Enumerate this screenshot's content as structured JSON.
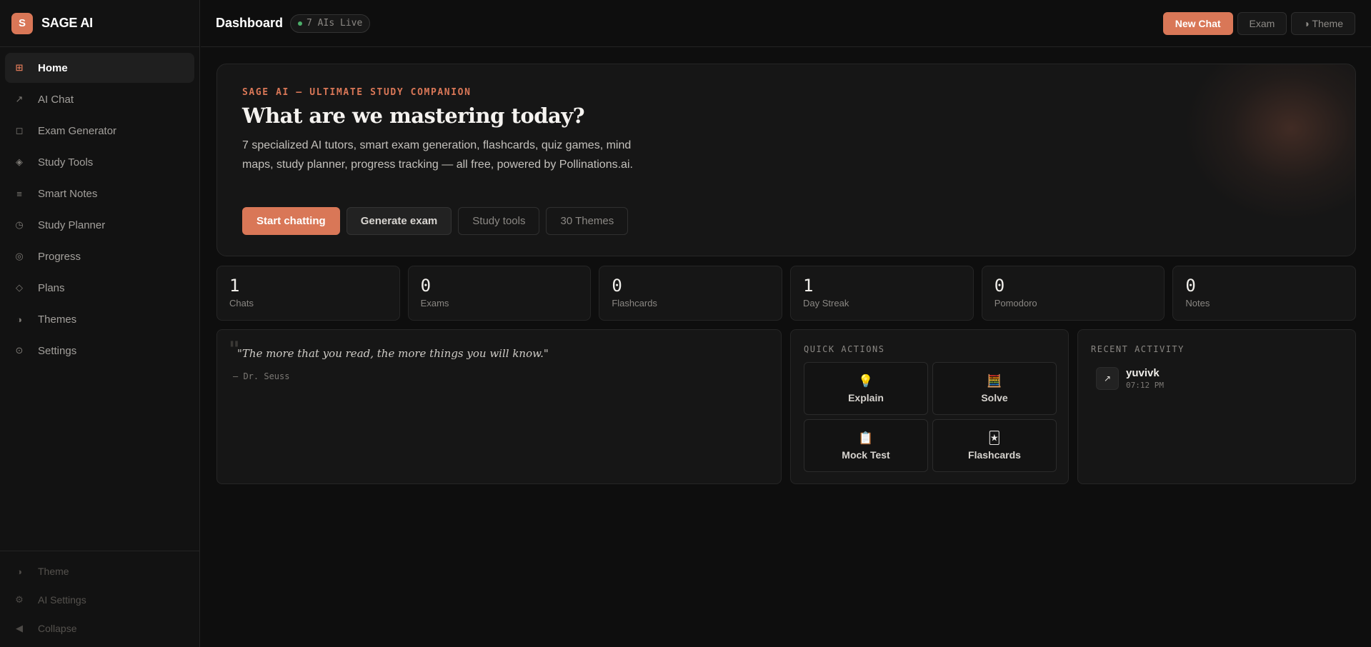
{
  "brand": {
    "logo_letter": "S",
    "name": "SAGE AI",
    "accent": "#d97757"
  },
  "sidebar": {
    "items": [
      {
        "label": "Home",
        "icon": "grid-icon",
        "glyph": "⊞",
        "active": true
      },
      {
        "label": "AI Chat",
        "icon": "arrow-icon",
        "glyph": "↗",
        "active": false
      },
      {
        "label": "Exam Generator",
        "icon": "square-icon",
        "glyph": "◻",
        "active": false
      },
      {
        "label": "Study Tools",
        "icon": "diamond-dot-icon",
        "glyph": "◈",
        "active": false
      },
      {
        "label": "Smart Notes",
        "icon": "lines-icon",
        "glyph": "≡",
        "active": false
      },
      {
        "label": "Study Planner",
        "icon": "clock-icon",
        "glyph": "◷",
        "active": false
      },
      {
        "label": "Progress",
        "icon": "target-icon",
        "glyph": "◎",
        "active": false
      },
      {
        "label": "Plans",
        "icon": "diamond-icon",
        "glyph": "◇",
        "active": false
      },
      {
        "label": "Themes",
        "icon": "half-circle-icon",
        "glyph": "◑",
        "active": false
      },
      {
        "label": "Settings",
        "icon": "gear-icon",
        "glyph": "⊙",
        "active": false
      }
    ],
    "footer": [
      {
        "label": "Theme",
        "icon": "half-circle-icon",
        "glyph": "◑"
      },
      {
        "label": "AI Settings",
        "icon": "gear-icon",
        "glyph": "⚙"
      },
      {
        "label": "Collapse",
        "icon": "collapse-icon",
        "glyph": "◀"
      }
    ]
  },
  "header": {
    "title": "Dashboard",
    "live_badge": "7 AIs Live",
    "new_chat_label": "New Chat",
    "exam_label": "Exam",
    "theme_label": "◑ Theme"
  },
  "hero": {
    "eyebrow": "SAGE AI — ULTIMATE STUDY COMPANION",
    "title": "What are we mastering today?",
    "description": "7 specialized AI tutors, smart exam generation, flashcards, quiz games, mind maps, study planner, progress tracking — all free, powered by Pollinations.ai.",
    "buttons": {
      "start": "Start chatting",
      "generate": "Generate exam",
      "tools": "Study tools",
      "themes": "30 Themes"
    }
  },
  "stats": [
    {
      "value": "1",
      "label": "Chats"
    },
    {
      "value": "0",
      "label": "Exams"
    },
    {
      "value": "0",
      "label": "Flashcards"
    },
    {
      "value": "1",
      "label": "Day Streak"
    },
    {
      "value": "0",
      "label": "Pomodoro"
    },
    {
      "value": "0",
      "label": "Notes"
    }
  ],
  "quote": {
    "mark": "\"",
    "text": "\"The more that you read, the more things you will know.\"",
    "author": "— Dr. Seuss"
  },
  "quick_actions": {
    "heading": "QUICK ACTIONS",
    "items": [
      {
        "label": "Explain",
        "icon": "lightbulb-icon",
        "glyph": "💡"
      },
      {
        "label": "Solve",
        "icon": "abacus-icon",
        "glyph": "🧮"
      },
      {
        "label": "Mock Test",
        "icon": "clipboard-icon",
        "glyph": "📋"
      },
      {
        "label": "Flashcards",
        "icon": "cards-icon",
        "glyph": "🃏"
      }
    ]
  },
  "recent_activity": {
    "heading": "RECENT ACTIVITY",
    "items": [
      {
        "name": "yuvivk",
        "time": "07:12 PM",
        "icon": "arrow-icon",
        "glyph": "↗"
      }
    ]
  }
}
